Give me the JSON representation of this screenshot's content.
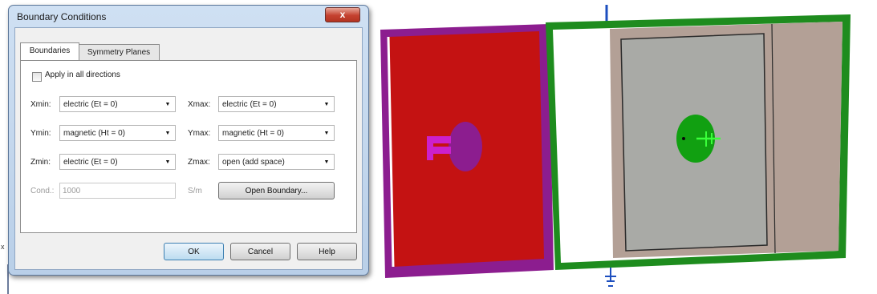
{
  "dialog": {
    "title": "Boundary Conditions",
    "close_symbol": "x",
    "tabs": [
      {
        "label": "Boundaries",
        "active": true
      },
      {
        "label": "Symmetry Planes",
        "active": false
      }
    ],
    "apply_all": {
      "label": "Apply in all directions",
      "checked": false
    },
    "fields": {
      "xmin": {
        "label": "Xmin:",
        "value": "electric (Et = 0)"
      },
      "xmax": {
        "label": "Xmax:",
        "value": "electric (Et = 0)"
      },
      "ymin": {
        "label": "Ymin:",
        "value": "magnetic (Ht = 0)"
      },
      "ymax": {
        "label": "Ymax:",
        "value": "magnetic (Ht = 0)"
      },
      "zmin": {
        "label": "Zmin:",
        "value": "electric (Et = 0)"
      },
      "zmax": {
        "label": "Zmax:",
        "value": "open (add space)"
      }
    },
    "cond": {
      "label": "Cond.:",
      "value": "1000",
      "unit": "S/m",
      "enabled": false
    },
    "open_boundary_button": "Open Boundary...",
    "ok_button": "OK",
    "cancel_button": "Cancel",
    "help_button": "Help"
  },
  "background": {
    "left_marker": "x"
  },
  "view3d": {
    "colors": {
      "background": "#ffffff",
      "left_frame": "#8c1d8f",
      "left_substrate": "#c41212",
      "right_frame": "#1e8c1e",
      "right_substrate": "#b3a096",
      "inner_plate": "#a9aaa6",
      "port": "#8c1d8f",
      "feed": "#cc20cc",
      "green_disk": "#11a011",
      "axis": "#1d4fbf"
    }
  }
}
